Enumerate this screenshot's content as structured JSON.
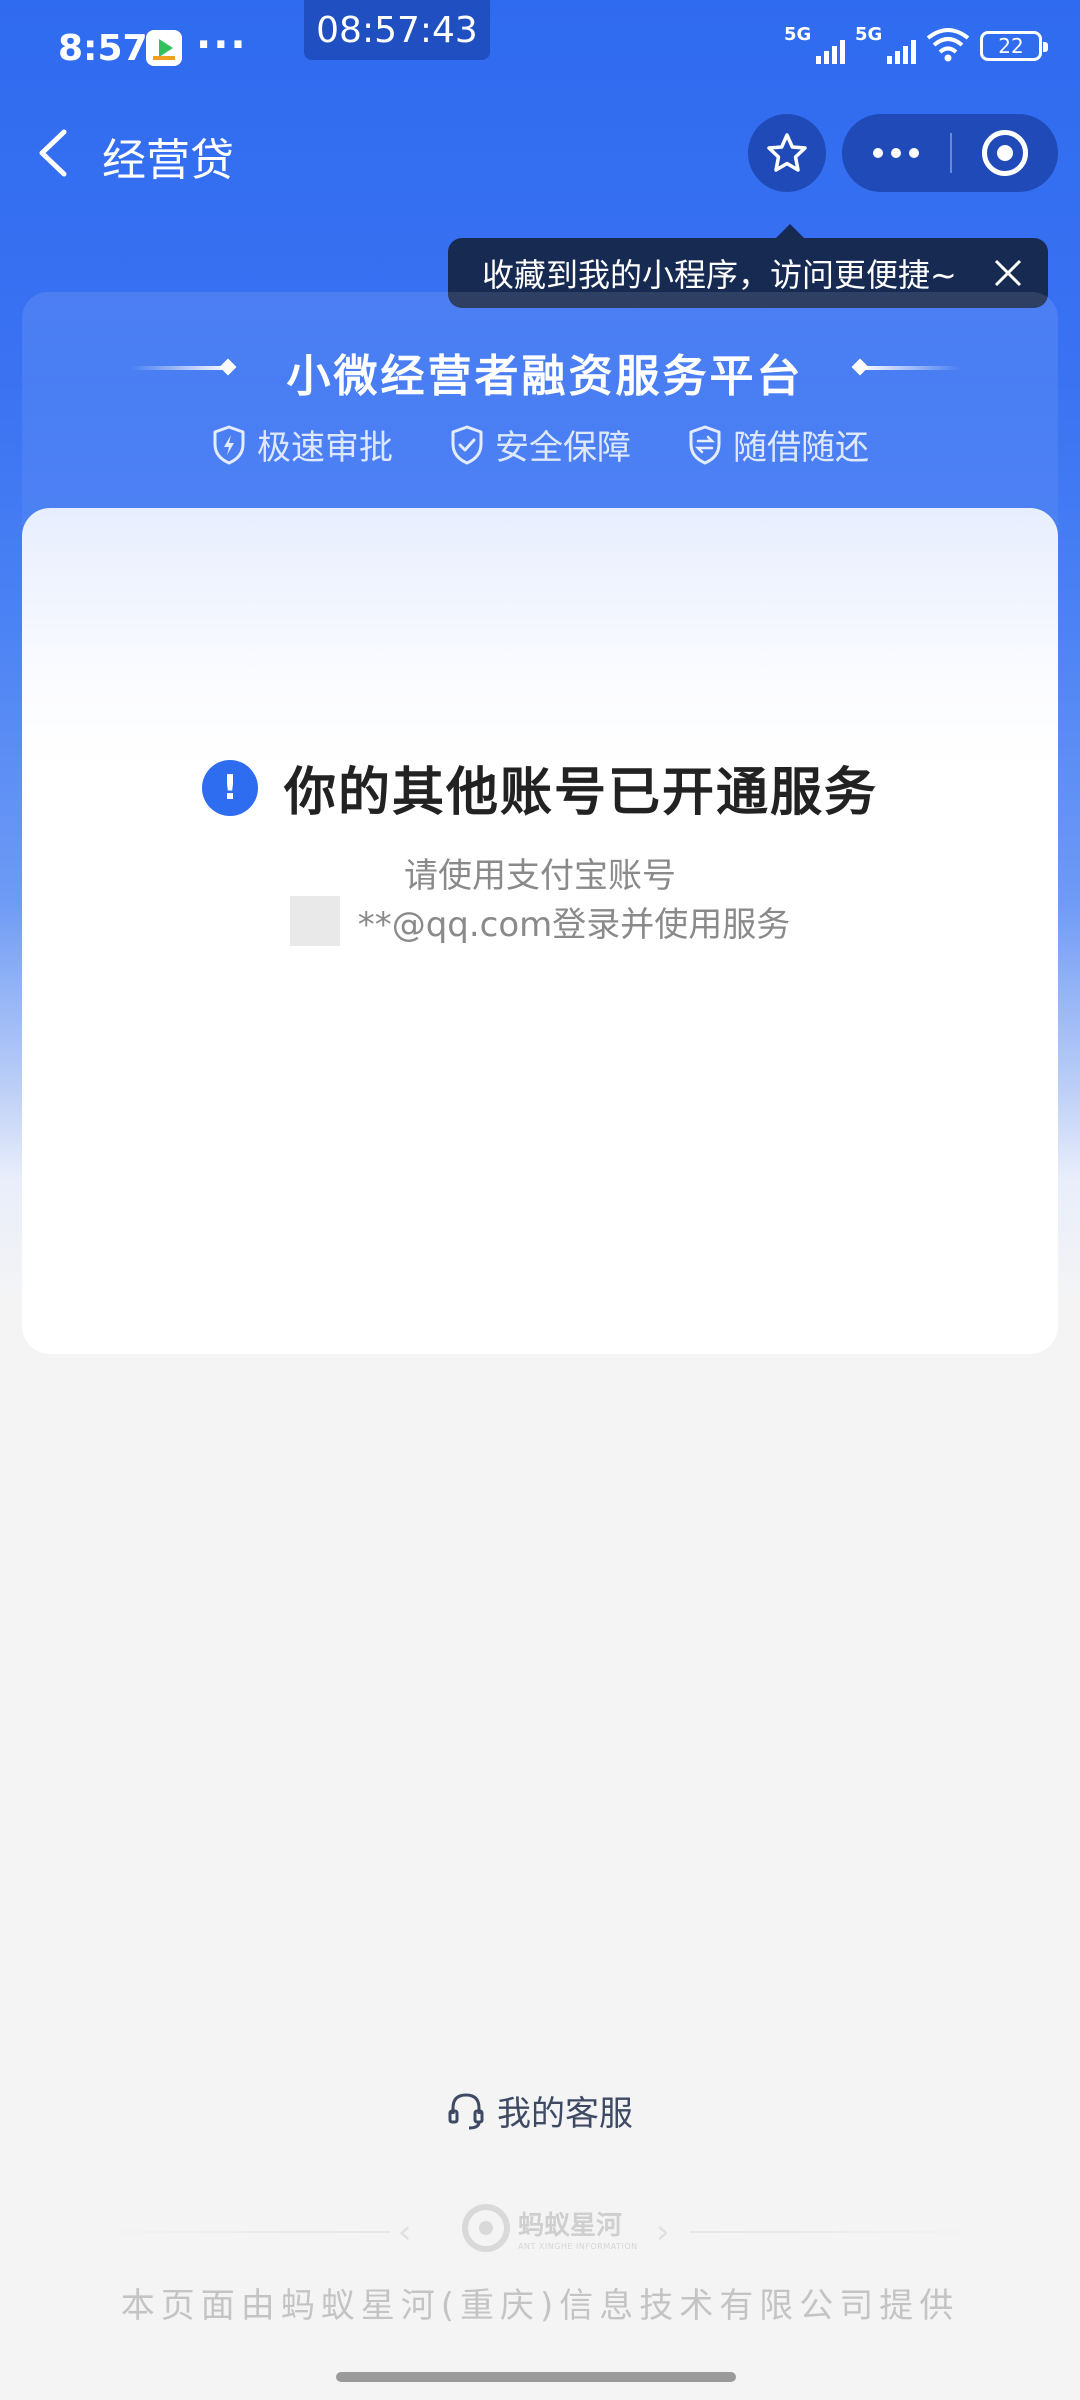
{
  "status_bar": {
    "time": "8:57",
    "clock_overlay": "08:57:43",
    "more_dots": "···",
    "signal1": "5G",
    "signal2": "5G",
    "battery": "22"
  },
  "nav": {
    "title": "经营贷"
  },
  "tooltip": {
    "text": "收藏到我的小程序，访问更便捷~"
  },
  "header": {
    "title": "小微经营者融资服务平台",
    "features": [
      {
        "label": "极速审批",
        "icon": "lightning-shield-icon"
      },
      {
        "label": "安全保障",
        "icon": "check-shield-icon"
      },
      {
        "label": "随借随还",
        "icon": "exchange-shield-icon"
      }
    ]
  },
  "message": {
    "title": "你的其他账号已开通服务",
    "line1": "请使用支付宝账号",
    "line2": "**@qq.com登录并使用服务"
  },
  "service": {
    "label": "我的客服"
  },
  "footer": {
    "logo_cn": "蚂蚁星河",
    "logo_en": "ANT XINGHE INFORMATION",
    "provider_text": "本页面由蚂蚁星河(重庆)信息技术有限公司提供"
  },
  "colors": {
    "brand_blue": "#2f6bf0",
    "info_blue": "#2e6cf0",
    "tooltip_bg": "#172a52"
  }
}
